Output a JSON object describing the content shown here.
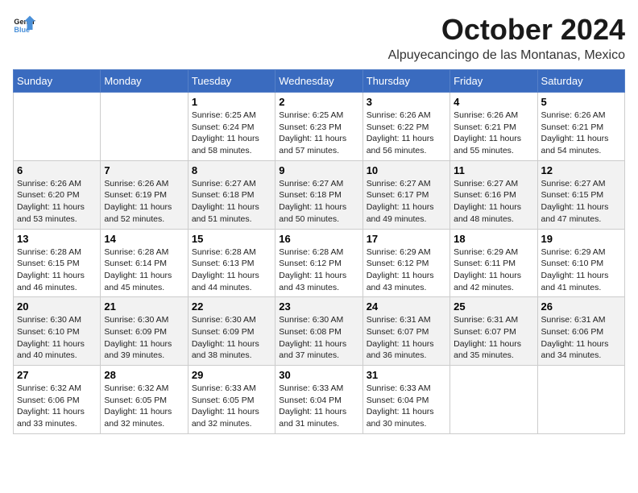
{
  "logo": {
    "line1": "General",
    "line2": "Blue"
  },
  "title": "October 2024",
  "location": "Alpuyecancingo de las Montanas, Mexico",
  "weekdays": [
    "Sunday",
    "Monday",
    "Tuesday",
    "Wednesday",
    "Thursday",
    "Friday",
    "Saturday"
  ],
  "weeks": [
    [
      null,
      null,
      {
        "day": 1,
        "sunrise": "6:25 AM",
        "sunset": "6:24 PM",
        "daylight": "11 hours and 58 minutes."
      },
      {
        "day": 2,
        "sunrise": "6:25 AM",
        "sunset": "6:23 PM",
        "daylight": "11 hours and 57 minutes."
      },
      {
        "day": 3,
        "sunrise": "6:26 AM",
        "sunset": "6:22 PM",
        "daylight": "11 hours and 56 minutes."
      },
      {
        "day": 4,
        "sunrise": "6:26 AM",
        "sunset": "6:21 PM",
        "daylight": "11 hours and 55 minutes."
      },
      {
        "day": 5,
        "sunrise": "6:26 AM",
        "sunset": "6:21 PM",
        "daylight": "11 hours and 54 minutes."
      }
    ],
    [
      {
        "day": 6,
        "sunrise": "6:26 AM",
        "sunset": "6:20 PM",
        "daylight": "11 hours and 53 minutes."
      },
      {
        "day": 7,
        "sunrise": "6:26 AM",
        "sunset": "6:19 PM",
        "daylight": "11 hours and 52 minutes."
      },
      {
        "day": 8,
        "sunrise": "6:27 AM",
        "sunset": "6:18 PM",
        "daylight": "11 hours and 51 minutes."
      },
      {
        "day": 9,
        "sunrise": "6:27 AM",
        "sunset": "6:18 PM",
        "daylight": "11 hours and 50 minutes."
      },
      {
        "day": 10,
        "sunrise": "6:27 AM",
        "sunset": "6:17 PM",
        "daylight": "11 hours and 49 minutes."
      },
      {
        "day": 11,
        "sunrise": "6:27 AM",
        "sunset": "6:16 PM",
        "daylight": "11 hours and 48 minutes."
      },
      {
        "day": 12,
        "sunrise": "6:27 AM",
        "sunset": "6:15 PM",
        "daylight": "11 hours and 47 minutes."
      }
    ],
    [
      {
        "day": 13,
        "sunrise": "6:28 AM",
        "sunset": "6:15 PM",
        "daylight": "11 hours and 46 minutes."
      },
      {
        "day": 14,
        "sunrise": "6:28 AM",
        "sunset": "6:14 PM",
        "daylight": "11 hours and 45 minutes."
      },
      {
        "day": 15,
        "sunrise": "6:28 AM",
        "sunset": "6:13 PM",
        "daylight": "11 hours and 44 minutes."
      },
      {
        "day": 16,
        "sunrise": "6:28 AM",
        "sunset": "6:12 PM",
        "daylight": "11 hours and 43 minutes."
      },
      {
        "day": 17,
        "sunrise": "6:29 AM",
        "sunset": "6:12 PM",
        "daylight": "11 hours and 43 minutes."
      },
      {
        "day": 18,
        "sunrise": "6:29 AM",
        "sunset": "6:11 PM",
        "daylight": "11 hours and 42 minutes."
      },
      {
        "day": 19,
        "sunrise": "6:29 AM",
        "sunset": "6:10 PM",
        "daylight": "11 hours and 41 minutes."
      }
    ],
    [
      {
        "day": 20,
        "sunrise": "6:30 AM",
        "sunset": "6:10 PM",
        "daylight": "11 hours and 40 minutes."
      },
      {
        "day": 21,
        "sunrise": "6:30 AM",
        "sunset": "6:09 PM",
        "daylight": "11 hours and 39 minutes."
      },
      {
        "day": 22,
        "sunrise": "6:30 AM",
        "sunset": "6:09 PM",
        "daylight": "11 hours and 38 minutes."
      },
      {
        "day": 23,
        "sunrise": "6:30 AM",
        "sunset": "6:08 PM",
        "daylight": "11 hours and 37 minutes."
      },
      {
        "day": 24,
        "sunrise": "6:31 AM",
        "sunset": "6:07 PM",
        "daylight": "11 hours and 36 minutes."
      },
      {
        "day": 25,
        "sunrise": "6:31 AM",
        "sunset": "6:07 PM",
        "daylight": "11 hours and 35 minutes."
      },
      {
        "day": 26,
        "sunrise": "6:31 AM",
        "sunset": "6:06 PM",
        "daylight": "11 hours and 34 minutes."
      }
    ],
    [
      {
        "day": 27,
        "sunrise": "6:32 AM",
        "sunset": "6:06 PM",
        "daylight": "11 hours and 33 minutes."
      },
      {
        "day": 28,
        "sunrise": "6:32 AM",
        "sunset": "6:05 PM",
        "daylight": "11 hours and 32 minutes."
      },
      {
        "day": 29,
        "sunrise": "6:33 AM",
        "sunset": "6:05 PM",
        "daylight": "11 hours and 32 minutes."
      },
      {
        "day": 30,
        "sunrise": "6:33 AM",
        "sunset": "6:04 PM",
        "daylight": "11 hours and 31 minutes."
      },
      {
        "day": 31,
        "sunrise": "6:33 AM",
        "sunset": "6:04 PM",
        "daylight": "11 hours and 30 minutes."
      },
      null,
      null
    ]
  ]
}
